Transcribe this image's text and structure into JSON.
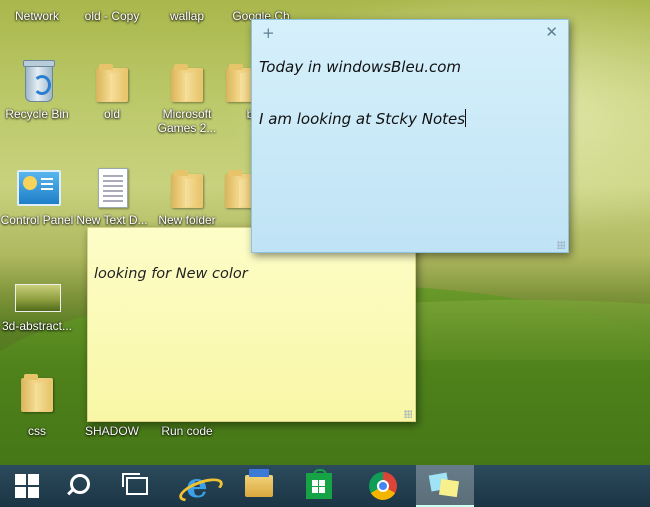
{
  "desktop": {
    "icons": [
      {
        "label": "Network"
      },
      {
        "label": "old - Copy"
      },
      {
        "label": "wallap"
      },
      {
        "label": "Google Ch"
      },
      {
        "label": "Recycle Bin"
      },
      {
        "label": "old"
      },
      {
        "label": "Microsoft Games 2..."
      },
      {
        "label": "ba"
      },
      {
        "label": "Control Panel"
      },
      {
        "label": "New Text D..."
      },
      {
        "label": "New folder"
      },
      {
        "label": "3d-abstract..."
      },
      {
        "label": "css"
      },
      {
        "label": "SHADOW"
      },
      {
        "label": "Run code"
      }
    ]
  },
  "notes": {
    "blue": {
      "add_glyph": "+",
      "close_glyph": "✕",
      "line1": "Today in windowsBleu.com",
      "line2": "I am looking at Stcky Notes",
      "color": "#c8e8f7"
    },
    "yellow": {
      "line1": "looking for New color",
      "color": "#fcfab9"
    }
  },
  "taskbar": {
    "items": [
      {
        "icon": "windows-start-icon"
      },
      {
        "icon": "search-icon"
      },
      {
        "icon": "task-view-icon"
      },
      {
        "icon": "internet-explorer-icon"
      },
      {
        "icon": "file-explorer-icon"
      },
      {
        "icon": "windows-store-icon"
      },
      {
        "icon": "chrome-icon"
      },
      {
        "icon": "sticky-notes-icon",
        "active": true
      }
    ],
    "color": "#1f3a4a"
  }
}
